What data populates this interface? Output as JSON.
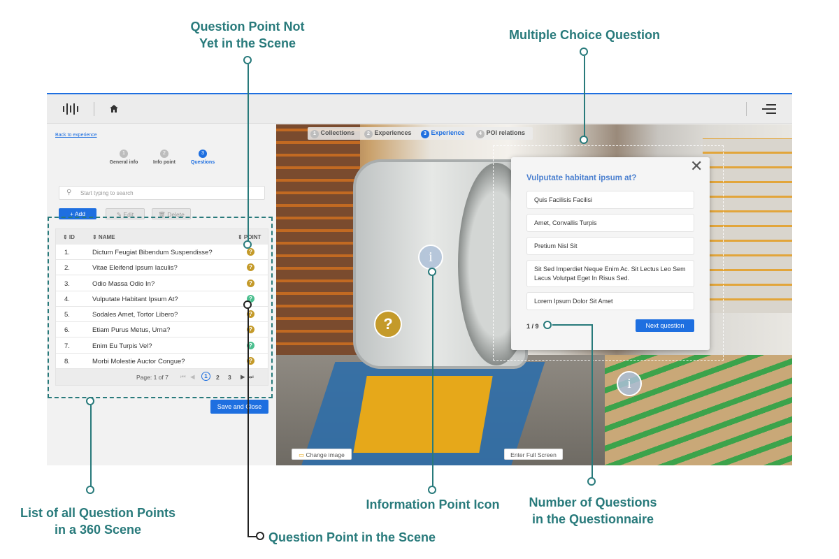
{
  "callouts": {
    "not_in_scene_1": "Question Point Not",
    "not_in_scene_2": "Yet in the Scene",
    "mcq": "Multiple Choice Question",
    "list_1": "List of all Question Points",
    "list_2": "in a 360 Scene",
    "in_scene": "Question Point in the Scene",
    "info_icon": "Information Point Icon",
    "num_q_1": "Number of Questions",
    "num_q_2": "in the Questionnaire"
  },
  "topbar": {
    "logo_icon": "waveform-logo-icon",
    "home_icon": "home-icon",
    "menu_icon": "hamburger-menu-icon"
  },
  "left": {
    "back_link": "Back to experience",
    "steps": [
      {
        "num": "1",
        "label": "General info"
      },
      {
        "num": "2",
        "label": "Info point"
      },
      {
        "num": "3",
        "label": "Questions"
      }
    ],
    "search_placeholder": "Start typing to search",
    "add_label": "+ Add",
    "edit_label": "✎ Edit",
    "delete_label": "🗑 Delete",
    "table": {
      "headers": {
        "id": "⇕ ID",
        "name": "⇕ NAME",
        "point": "⇕ POINT"
      },
      "rows": [
        {
          "id": "1.",
          "name": "Dictum Feugiat Bibendum Suspendisse?",
          "color": "#c49a2a"
        },
        {
          "id": "2.",
          "name": "Vitae Eleifend Ipsum Iaculis?",
          "color": "#c49a2a"
        },
        {
          "id": "3.",
          "name": "Odio Massa Odio In?",
          "color": "#c49a2a"
        },
        {
          "id": "4.",
          "name": "Vulputate Habitant Ipsum At?",
          "color": "#4bbf8f"
        },
        {
          "id": "5.",
          "name": "Sodales Amet, Tortor Libero?",
          "color": "#c49a2a"
        },
        {
          "id": "6.",
          "name": "Etiam Purus Metus, Urna?",
          "color": "#c49a2a"
        },
        {
          "id": "7.",
          "name": "Enim Eu Turpis Vel?",
          "color": "#4bbf8f"
        },
        {
          "id": "8.",
          "name": "Morbi Molestie Auctor Congue?",
          "color": "#c49a2a"
        }
      ],
      "page_label": "Page: 1 of 7",
      "pages": [
        "1",
        "2",
        "3"
      ]
    },
    "save_label": "Save and Close"
  },
  "scene": {
    "steps": [
      {
        "num": "1",
        "label": "Collections"
      },
      {
        "num": "2",
        "label": "Experiences"
      },
      {
        "num": "3",
        "label": "Experience"
      },
      {
        "num": "4",
        "label": "POI relations"
      }
    ],
    "change_image": "Change image",
    "fullscreen": "Enter Full Screen"
  },
  "question": {
    "title": "Vulputate habitant ipsum at?",
    "answers": [
      "Quis Facilisis Facilisi",
      "Amet, Convallis Turpis",
      "Pretium Nisl Sit",
      "Sit Sed Imperdiet Neque Enim Ac. Sit Lectus Leo Sem Lacus Volutpat Eget In Risus Sed.",
      "Lorem Ipsum Dolor Sit Amet"
    ],
    "counter": "1 / 9",
    "next_label": "Next question",
    "close_icon": "close-icon"
  },
  "colors": {
    "accent": "#1e6fe0",
    "callout": "#287a7b",
    "gold": "#c49a2a",
    "green": "#4bbf8f"
  }
}
